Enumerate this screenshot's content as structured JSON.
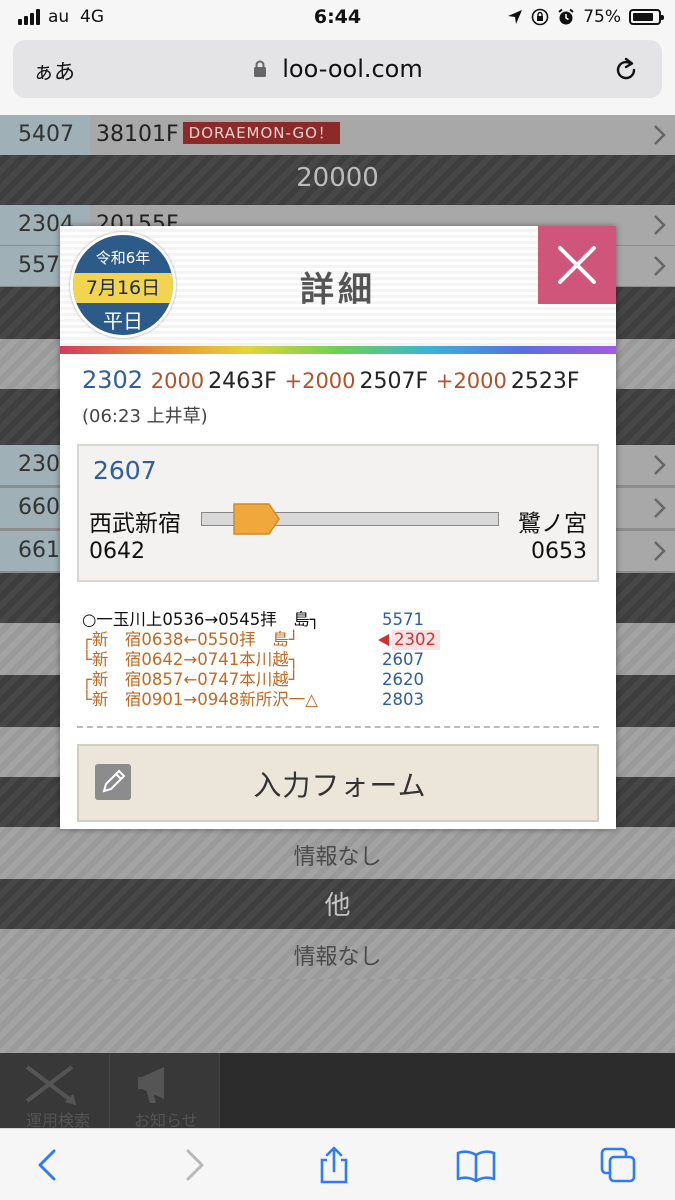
{
  "status": {
    "carrier": "au",
    "network": "4G",
    "time": "6:44",
    "battery": "75%"
  },
  "browser": {
    "text_size_button": "ぁあ",
    "url": "loo-ool.com"
  },
  "background": {
    "rows": [
      {
        "num": "5407",
        "value": "38101F",
        "tag": "DORAEMON-GO！"
      },
      {
        "num": "2304",
        "value": "20155F"
      },
      {
        "num": "557",
        "value": ""
      },
      {
        "num": "230",
        "value": ""
      },
      {
        "num": "660",
        "value": ""
      },
      {
        "num": "661",
        "value": ""
      }
    ],
    "heading_20000": "20000",
    "info_none_1": "情報なし",
    "heading_other": "他",
    "info_none_2": "情報なし",
    "bottom_cells": [
      "運用検索",
      "お知らせ"
    ]
  },
  "modal": {
    "title": "詳細",
    "date": {
      "era": "令和6年",
      "month_day": "7月16日",
      "day_type": "平日"
    },
    "chain": {
      "train": "2302",
      "seg1_type": "2000",
      "seg1_car": "2463F",
      "plus1": "+",
      "seg2_type": "2000",
      "seg2_car": "2507F",
      "plus2": "+",
      "seg3_type": "2000",
      "seg3_car": "2523F"
    },
    "sub": "(06:23 上井草)",
    "current": {
      "train_no": "2607",
      "from_station": "西武新宿",
      "to_station": "鷺ノ宮",
      "from_time": "0642",
      "to_time": "0653",
      "progress": 0.12
    },
    "schedule": [
      {
        "text": "○一玉川上0536→0545拝　島┐",
        "train": "5571",
        "color": "black",
        "current": false
      },
      {
        "text": "┌新　宿0638←0550拝　島┘",
        "train": "2302",
        "color": "orange",
        "current": true
      },
      {
        "text": "└新　宿0642→0741本川越┐",
        "train": "2607",
        "color": "orange",
        "current": false
      },
      {
        "text": "┌新　宿0857←0747本川越┘",
        "train": "2620",
        "color": "orange",
        "current": false
      },
      {
        "text": "└新　宿0901→0948新所沢一△",
        "train": "2803",
        "color": "orange",
        "current": false
      }
    ],
    "form_button": "入力フォーム"
  }
}
